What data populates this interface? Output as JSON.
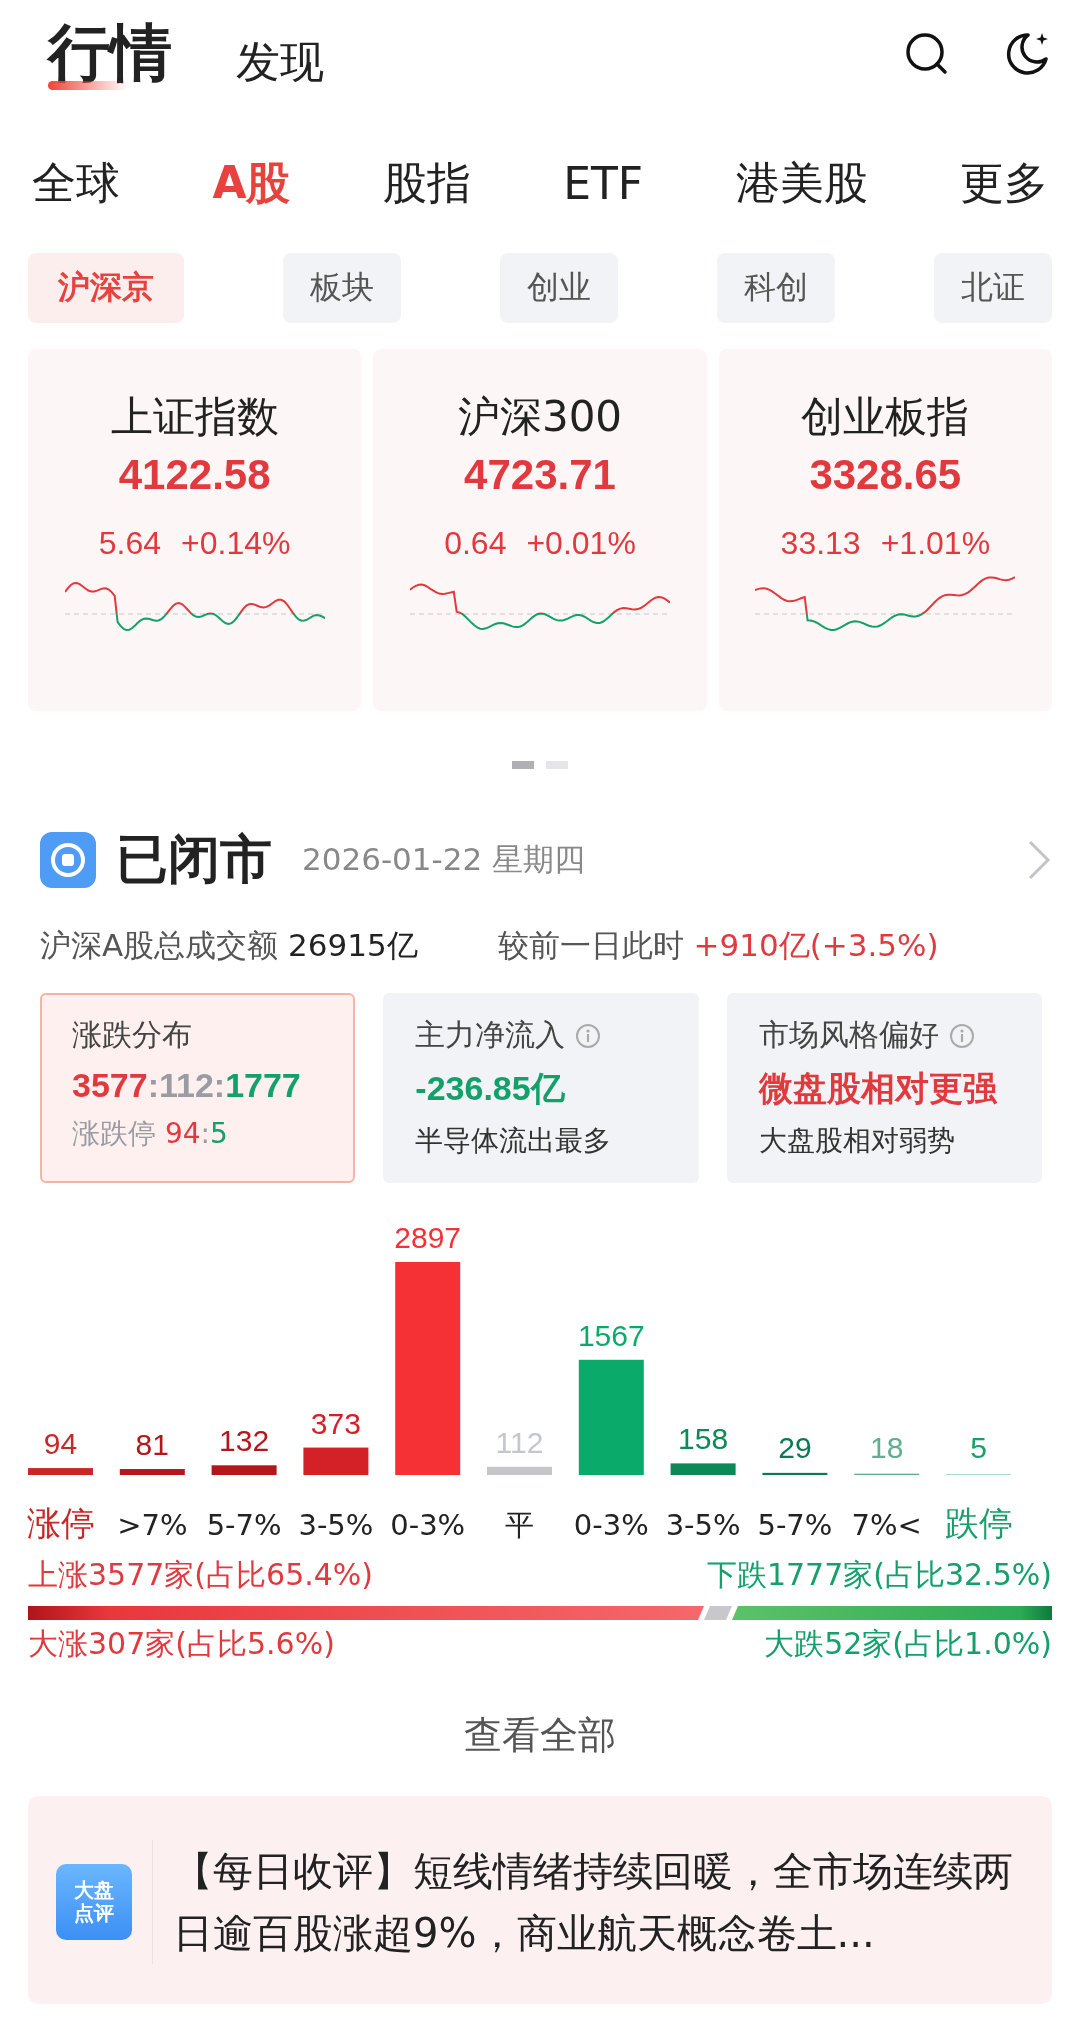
{
  "header": {
    "tabs": [
      {
        "label": "行情",
        "selected": true
      },
      {
        "label": "发现",
        "selected": false
      }
    ]
  },
  "market_tabs": [
    {
      "label": "全球",
      "selected": false
    },
    {
      "label": "A股",
      "selected": true
    },
    {
      "label": "股指",
      "selected": false
    },
    {
      "label": "ETF",
      "selected": false
    },
    {
      "label": "港美股",
      "selected": false
    },
    {
      "label": "更多",
      "selected": false
    }
  ],
  "sub_tabs": [
    {
      "label": "沪深京",
      "selected": true
    },
    {
      "label": "板块",
      "selected": false
    },
    {
      "label": "创业",
      "selected": false
    },
    {
      "label": "科创",
      "selected": false
    },
    {
      "label": "北证",
      "selected": false
    }
  ],
  "index_cards": [
    {
      "name": "上证指数",
      "value": "4122.58",
      "change": "5.64",
      "percent": "+0.14%"
    },
    {
      "name": "沪深300",
      "value": "4723.71",
      "change": "0.64",
      "percent": "+0.01%"
    },
    {
      "name": "创业板指",
      "value": "3328.65",
      "change": "33.13",
      "percent": "+1.01%"
    }
  ],
  "pager": [
    {
      "selected": true
    },
    {
      "selected": false
    }
  ],
  "market_status": {
    "title": "已闭市",
    "date": "2026-01-22 星期四",
    "turnover_label": "沪深A股总成交额",
    "turnover_value": "26915亿",
    "compare_label": "较前一日此时",
    "compare_value": "+910亿(+3.5%)"
  },
  "stat_cards": [
    {
      "title": "涨跌分布",
      "info": false,
      "selected": true,
      "value_parts": [
        {
          "text": "3577",
          "color": "#e0393e"
        },
        {
          "text": ":112:",
          "color": "#9a9ba3"
        },
        {
          "text": "1777",
          "color": "#13a06a"
        }
      ],
      "note_parts": [
        {
          "text": "涨跌停 ",
          "color": "#9a9ba3"
        },
        {
          "text": "94",
          "color": "#e0393e"
        },
        {
          "text": ":",
          "color": "#9a9ba3"
        },
        {
          "text": "5",
          "color": "#13a06a"
        }
      ]
    },
    {
      "title": "主力净流入",
      "info": true,
      "selected": false,
      "value_parts": [
        {
          "text": "-236.85亿",
          "color": "#13a06a"
        }
      ],
      "note_parts": [
        {
          "text": "半导体流出最多",
          "color": "#333333"
        }
      ]
    },
    {
      "title": "市场风格偏好",
      "info": true,
      "selected": false,
      "value_parts": [
        {
          "text": "微盘股相对更强",
          "color": "#e0393e"
        }
      ],
      "note_parts": [
        {
          "text": "大盘股相对弱势",
          "color": "#333333"
        }
      ]
    }
  ],
  "distribution": {
    "chart_data": {
      "type": "bar",
      "categories": [
        "涨停",
        ">7%",
        "5-7%",
        "3-5%",
        "0-3%",
        "平",
        "0-3%",
        "3-5%",
        "5-7%",
        "7%<",
        "跌停"
      ],
      "values": [
        94,
        81,
        132,
        373,
        2897,
        112,
        1567,
        158,
        29,
        18,
        5
      ],
      "data_labels": true,
      "colors": [
        "#c62828",
        "#b3171c",
        "#b3171c",
        "#d42128",
        "#f53136",
        "#c5c6ca",
        "#0aab6a",
        "#0b8a57",
        "#0b7a52",
        "#5fae8e",
        "#17a06a"
      ]
    }
  },
  "breadth": {
    "up_label": "上涨3577家(占比65.4%)",
    "down_label": "下跌1777家(占比32.5%)",
    "big_up_label": "大涨307家(占比5.6%)",
    "big_down_label": "大跌52家(占比1.0%)"
  },
  "view_all": "查看全部",
  "news": {
    "badge": "大盘点评",
    "text": "【每日收评】短线情绪持续回暖，全市场连续两日逾百股涨超9%，商业航天概念卷土..."
  }
}
